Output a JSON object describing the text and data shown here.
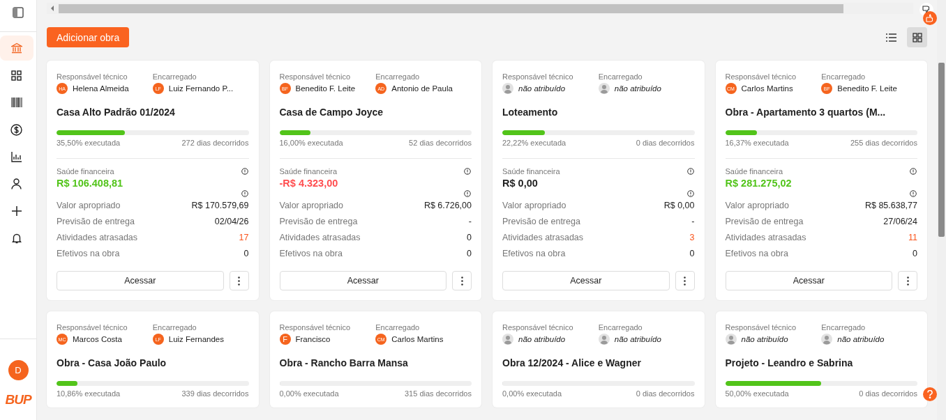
{
  "sidebar": {
    "items": [
      {
        "selected": true
      },
      {
        "selected": false
      },
      {
        "selected": false
      },
      {
        "selected": false
      },
      {
        "selected": false
      },
      {
        "selected": false
      },
      {
        "selected": false
      },
      {
        "selected": false
      }
    ],
    "avatar": "D",
    "logo": "BUP"
  },
  "toolbar": {
    "add_button": "Adicionar obra",
    "views": [
      {
        "kind": "list",
        "selected": false
      },
      {
        "kind": "grid",
        "selected": true
      }
    ]
  },
  "cards": [
    {
      "technical": {
        "label": "Responsável técnico",
        "initials": "HA",
        "name": "Helena Almeida",
        "assigned": true
      },
      "foreman": {
        "label": "Encarregado",
        "initials": "LF",
        "name": "Luiz Fernando P...",
        "assigned": true
      },
      "title": "Casa Alto Padrão 01/2024",
      "level": 0.355,
      "executed": "35,50% executada",
      "days": "272 dias decorridos",
      "health": {
        "label": "Saúde financeira",
        "value": "R$ 106.408,81",
        "color": "#52c41a"
      },
      "rows": [
        {
          "label": "Valor apropriado",
          "value": "R$ 170.579,69",
          "alert": false
        },
        {
          "label": "Previsão de entrega",
          "value": "02/04/26",
          "alert": false
        },
        {
          "label": "Atividades atrasadas",
          "value": "17",
          "alert": true
        },
        {
          "label": "Efetivos na obra",
          "value": "0",
          "alert": false
        }
      ],
      "access": "Acessar"
    },
    {
      "technical": {
        "label": "Responsável técnico",
        "initials": "BF",
        "name": "Benedito F. Leite",
        "assigned": true
      },
      "foreman": {
        "label": "Encarregado",
        "initials": "AD",
        "name": "Antonio de Paula",
        "assigned": true
      },
      "title": "Casa de Campo Joyce",
      "level": 0.16,
      "executed": "16,00% executada",
      "days": "52 dias decorridos",
      "health": {
        "label": "Saúde financeira",
        "value": "-R$ 4.323,00",
        "color": "#ff4d4f"
      },
      "rows": [
        {
          "label": "Valor apropriado",
          "value": "R$ 6.726,00",
          "alert": false
        },
        {
          "label": "Previsão de entrega",
          "value": "-",
          "alert": false
        },
        {
          "label": "Atividades atrasadas",
          "value": "0",
          "alert": false
        },
        {
          "label": "Efetivos na obra",
          "value": "0",
          "alert": false
        }
      ],
      "access": "Acessar"
    },
    {
      "technical": {
        "label": "Responsável técnico",
        "name": "não atribuído",
        "assigned": false
      },
      "foreman": {
        "label": "Encarregado",
        "name": "não atribuído",
        "assigned": false
      },
      "title": "Loteamento",
      "level": 0.2222,
      "executed": "22,22% executada",
      "days": "0 dias decorridos",
      "health": {
        "label": "Saúde financeira",
        "value": "R$ 0,00",
        "color": "#222222"
      },
      "rows": [
        {
          "label": "Valor apropriado",
          "value": "R$ 0,00",
          "alert": false
        },
        {
          "label": "Previsão de entrega",
          "value": "-",
          "alert": false
        },
        {
          "label": "Atividades atrasadas",
          "value": "3",
          "alert": true
        },
        {
          "label": "Efetivos na obra",
          "value": "0",
          "alert": false
        }
      ],
      "access": "Acessar"
    },
    {
      "technical": {
        "label": "Responsável técnico",
        "initials": "CM",
        "name": "Carlos Martins",
        "assigned": true
      },
      "foreman": {
        "label": "Encarregado",
        "initials": "BF",
        "name": "Benedito F. Leite",
        "assigned": true
      },
      "title": "Obra - Apartamento 3 quartos (M...",
      "level": 0.1637,
      "executed": "16,37% executada",
      "days": "255 dias decorridos",
      "health": {
        "label": "Saúde financeira",
        "value": "R$ 281.275,02",
        "color": "#52c41a"
      },
      "rows": [
        {
          "label": "Valor apropriado",
          "value": "R$ 85.638,77",
          "alert": false
        },
        {
          "label": "Previsão de entrega",
          "value": "27/06/24",
          "alert": false
        },
        {
          "label": "Atividades atrasadas",
          "value": "11",
          "alert": true
        },
        {
          "label": "Efetivos na obra",
          "value": "0",
          "alert": false
        }
      ],
      "access": "Acessar"
    },
    {
      "technical": {
        "label": "Responsável técnico",
        "initials": "MC",
        "name": "Marcos Costa",
        "assigned": true
      },
      "foreman": {
        "label": "Encarregado",
        "initials": "LF",
        "name": "Luiz Fernandes",
        "assigned": true
      },
      "title": "Obra - Casa João Paulo",
      "level": 0.1086,
      "executed": "10,86% executada",
      "days": "339 dias decorridos"
    },
    {
      "technical": {
        "label": "Responsável técnico",
        "initials": "F",
        "name": "Francisco",
        "assigned": true
      },
      "foreman": {
        "label": "Encarregado",
        "initials": "CM",
        "name": "Carlos Martins",
        "assigned": true
      },
      "title": "Obra - Rancho Barra Mansa",
      "level": 0,
      "executed": "0,00% executada",
      "days": "315 dias decorridos"
    },
    {
      "technical": {
        "label": "Responsável técnico",
        "name": "não atribuído",
        "assigned": false
      },
      "foreman": {
        "label": "Encarregado",
        "name": "não atribuído",
        "assigned": false
      },
      "title": "Obra 12/2024 - Alice e Wagner",
      "level": 0,
      "executed": "0,00% executada",
      "days": "0 dias decorridos"
    },
    {
      "technical": {
        "label": "Responsável técnico",
        "name": "não atribuído",
        "assigned": false
      },
      "foreman": {
        "label": "Encarregado",
        "name": "não atribuído",
        "assigned": false
      },
      "title": "Projeto - Leandro e Sabrina",
      "level": 0.5,
      "executed": "50,00% executada",
      "days": "0 dias decorridos"
    }
  ]
}
